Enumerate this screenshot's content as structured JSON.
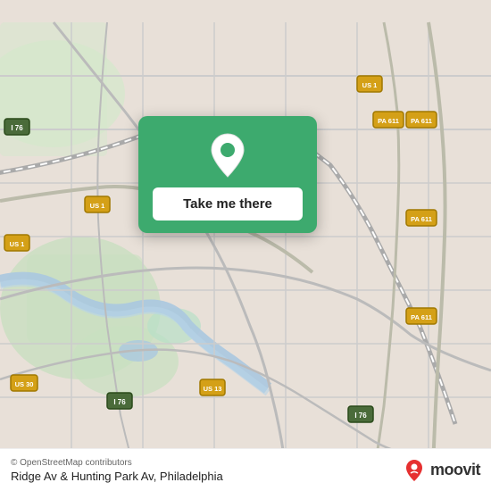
{
  "map": {
    "background_color": "#e8e0d8"
  },
  "card": {
    "button_label": "Take me there",
    "background_color": "#3daa6e"
  },
  "bottom_bar": {
    "attribution": "© OpenStreetMap contributors",
    "location_name": "Ridge Av & Hunting Park Av, Philadelphia"
  },
  "moovit": {
    "logo_text": "moovit"
  },
  "road_labels": {
    "i76_1": "I 76",
    "i76_2": "I 76",
    "i76_3": "I 76",
    "us1_1": "US 1",
    "us1_2": "US 1",
    "us1_3": "US 1",
    "us13": "US 13",
    "us30": "US 30",
    "pa611_1": "PA 611",
    "pa611_2": "PA 611",
    "pa611_3": "PA 611",
    "pa611_4": "PA 611"
  }
}
